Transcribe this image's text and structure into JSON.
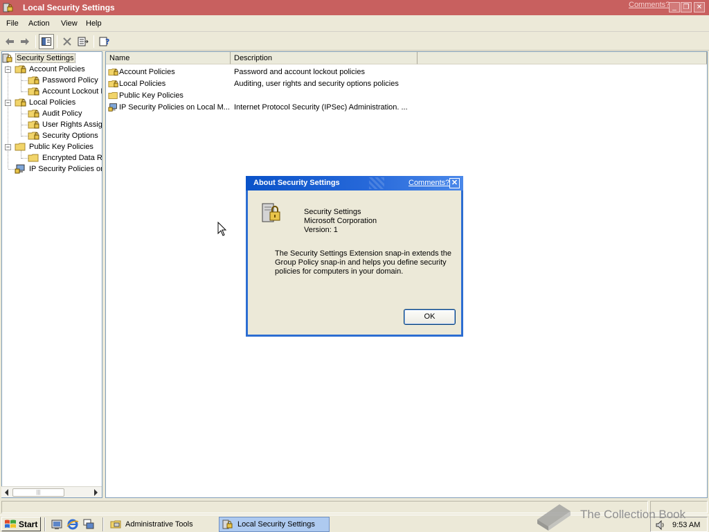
{
  "window": {
    "title": "Local Security Settings",
    "comments_link": "Comments?",
    "controls": {
      "minimize": "_",
      "restore": "❐",
      "close": "✕"
    }
  },
  "menu": [
    "File",
    "Action",
    "View",
    "Help"
  ],
  "toolbar": {
    "buttons": [
      "back-icon",
      "forward-icon",
      "show-hide-tree-icon",
      "delete-icon",
      "export-list-icon",
      "help-icon"
    ]
  },
  "tree": {
    "items": [
      {
        "label": "Security Settings",
        "level": 0,
        "expander": "",
        "icon": "security-settings-icon",
        "selected": true
      },
      {
        "label": "Account Policies",
        "level": 1,
        "expander": "−",
        "icon": "locked-folder-icon"
      },
      {
        "label": "Password Policy",
        "level": 2,
        "expander": "",
        "icon": "locked-folder-icon"
      },
      {
        "label": "Account Lockout P",
        "level": 2,
        "expander": "",
        "icon": "locked-folder-icon"
      },
      {
        "label": "Local Policies",
        "level": 1,
        "expander": "−",
        "icon": "locked-folder-icon"
      },
      {
        "label": "Audit Policy",
        "level": 2,
        "expander": "",
        "icon": "locked-folder-icon"
      },
      {
        "label": "User Rights Assign",
        "level": 2,
        "expander": "",
        "icon": "locked-folder-icon"
      },
      {
        "label": "Security Options",
        "level": 2,
        "expander": "",
        "icon": "locked-folder-icon"
      },
      {
        "label": "Public Key Policies",
        "level": 1,
        "expander": "−",
        "icon": "folder-icon"
      },
      {
        "label": "Encrypted Data R",
        "level": 2,
        "expander": "",
        "icon": "folder-icon"
      },
      {
        "label": "IP Security Policies on",
        "level": 1,
        "expander": "",
        "icon": "ip-security-icon"
      }
    ]
  },
  "list": {
    "columns": [
      "Name",
      "Description"
    ],
    "rows": [
      {
        "name": "Account Policies",
        "description": "Password and account lockout policies",
        "icon": "locked-folder-icon"
      },
      {
        "name": "Local Policies",
        "description": "Auditing, user rights and security options policies",
        "icon": "locked-folder-icon"
      },
      {
        "name": "Public Key Policies",
        "description": "",
        "icon": "folder-icon"
      },
      {
        "name": "IP Security Policies on Local M...",
        "description": "Internet Protocol Security (IPSec) Administration. ...",
        "icon": "ip-security-icon"
      }
    ]
  },
  "dialog": {
    "title": "About Security Settings",
    "comments_link": "Comments?",
    "close": "✕",
    "product": "Security Settings",
    "company": "Microsoft Corporation",
    "version": "Version: 1",
    "description": "The Security Settings Extension snap-in extends the Group Policy snap-in and helps you define security policies for computers in your domain.",
    "ok_label": "OK"
  },
  "taskbar": {
    "start_label": "Start",
    "quick_launch": [
      "show-desktop-icon",
      "internet-explorer-icon",
      "switch-windows-icon"
    ],
    "tasks": [
      {
        "label": "Administrative Tools",
        "icon": "admin-tools-icon",
        "active": false
      },
      {
        "label": "Local Security Settings",
        "icon": "local-security-icon",
        "active": true
      }
    ],
    "clock": "9:53 AM"
  },
  "watermark": {
    "text": "The Collection Book"
  },
  "colors": {
    "titlebar": "#c8605f",
    "dialog_title": "#0a53c9",
    "face": "#ece9d8",
    "active_task": "#aecaf0"
  }
}
